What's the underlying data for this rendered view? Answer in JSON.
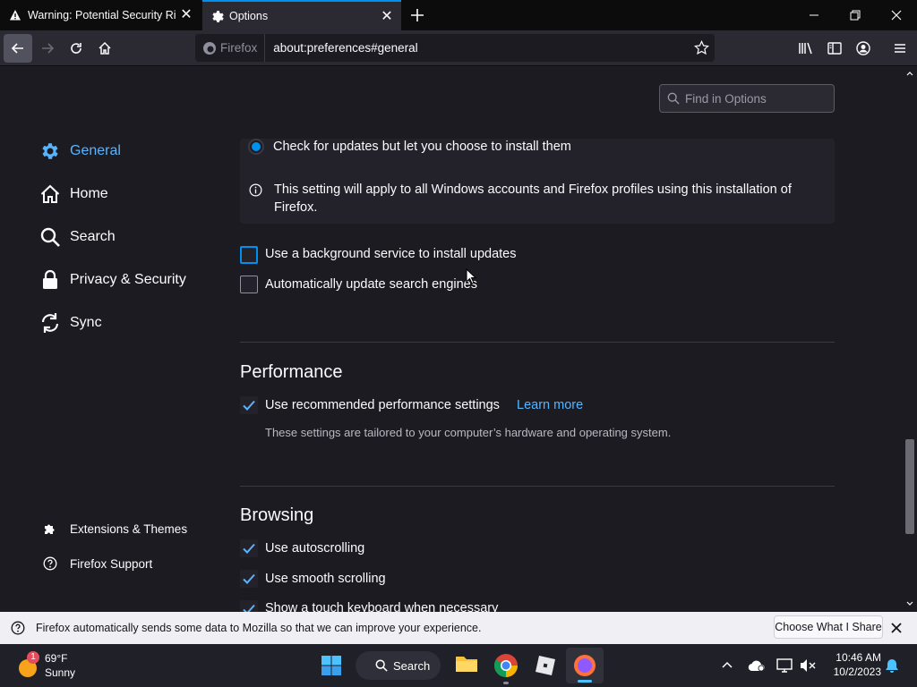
{
  "tabs": [
    {
      "title": "Warning: Potential Security Risk",
      "icon": "warning-icon"
    },
    {
      "title": "Options",
      "icon": "gear-icon"
    }
  ],
  "urlbar": {
    "identity": "Firefox",
    "url": "about:preferences#general"
  },
  "find": {
    "placeholder": "Find in Options"
  },
  "sidebar": {
    "items": [
      {
        "label": "General",
        "icon": "gear-icon",
        "selected": true
      },
      {
        "label": "Home",
        "icon": "home-icon"
      },
      {
        "label": "Search",
        "icon": "search-icon"
      },
      {
        "label": "Privacy & Security",
        "icon": "lock-icon"
      },
      {
        "label": "Sync",
        "icon": "sync-icon"
      }
    ],
    "footer": [
      {
        "label": "Extensions & Themes",
        "icon": "puzzle-icon"
      },
      {
        "label": "Firefox Support",
        "icon": "help-icon"
      }
    ]
  },
  "updates": {
    "radio_label": "Check for updates but let you choose to install them",
    "info_line1": "This setting will apply to all Windows accounts and Firefox profiles using this installation of",
    "info_line2": "Firefox.",
    "bg_service": "Use a background service to install updates",
    "auto_search": "Automatically update search engines"
  },
  "performance": {
    "title": "Performance",
    "recommended": "Use recommended performance settings",
    "learn_more": "Learn more",
    "note": "These settings are tailored to your computer’s hardware and operating system."
  },
  "browsing": {
    "title": "Browsing",
    "autoscroll": "Use autoscrolling",
    "smooth": "Use smooth scrolling",
    "touch": "Show a touch keyboard when necessary"
  },
  "notification": {
    "text": "Firefox automatically sends some data to Mozilla so that we can improve your experience.",
    "button": "Choose What I Share"
  },
  "taskbar": {
    "weather_temp": "69°F",
    "weather_cond": "Sunny",
    "weather_badge": "1",
    "search": "Search",
    "time": "10:46 AM",
    "date": "10/2/2023"
  },
  "colors": {
    "accent": "#0090ed",
    "link": "#54b6ff",
    "background": "#1c1b22"
  }
}
